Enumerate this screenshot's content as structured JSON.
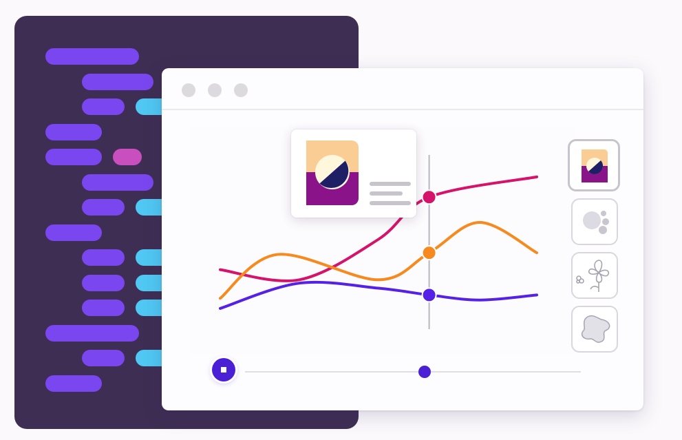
{
  "colors": {
    "code_background": "#3e2e54",
    "code_purple": "#7a46f0",
    "code_cyan": "#4fc8f3",
    "code_pink": "#c94fbf",
    "series_magenta": "#d6136a",
    "series_orange": "#f68a1f",
    "series_violet": "#5521e6",
    "accent": "#4a1fd6"
  },
  "code_editor": {
    "lines": [
      {
        "indent": 0,
        "tokens": [
          {
            "w": 136,
            "c": "purple"
          }
        ]
      },
      {
        "indent": 1,
        "tokens": [
          {
            "w": 104,
            "c": "purple"
          }
        ]
      },
      {
        "indent": 1,
        "tokens": [
          {
            "w": 62,
            "c": "purple"
          },
          {
            "w": 70,
            "c": "cyan"
          }
        ]
      },
      {
        "indent": 0,
        "tokens": [
          {
            "w": 82,
            "c": "purple"
          }
        ]
      },
      {
        "indent": 0,
        "tokens": [
          {
            "w": 82,
            "c": "purple"
          },
          {
            "w": 42,
            "c": "pink"
          }
        ]
      },
      {
        "indent": 1,
        "tokens": [
          {
            "w": 104,
            "c": "purple"
          }
        ]
      },
      {
        "indent": 1,
        "tokens": [
          {
            "w": 62,
            "c": "purple"
          },
          {
            "w": 70,
            "c": "cyan"
          }
        ]
      },
      {
        "indent": 0,
        "tokens": [
          {
            "w": 82,
            "c": "purple"
          }
        ]
      },
      {
        "indent": 1,
        "tokens": [
          {
            "w": 62,
            "c": "purple"
          },
          {
            "w": 70,
            "c": "cyan"
          }
        ]
      },
      {
        "indent": 1,
        "tokens": [
          {
            "w": 62,
            "c": "purple"
          },
          {
            "w": 70,
            "c": "cyan"
          }
        ]
      },
      {
        "indent": 1,
        "tokens": [
          {
            "w": 62,
            "c": "purple"
          },
          {
            "w": 70,
            "c": "cyan"
          }
        ]
      },
      {
        "indent": 0,
        "tokens": [
          {
            "w": 136,
            "c": "purple"
          }
        ]
      },
      {
        "indent": 1,
        "tokens": [
          {
            "w": 62,
            "c": "purple"
          },
          {
            "w": 70,
            "c": "cyan"
          }
        ]
      },
      {
        "indent": 0,
        "tokens": [
          {
            "w": 82,
            "c": "purple"
          }
        ]
      }
    ]
  },
  "window": {
    "controls": [
      "close-dot",
      "minimize-dot",
      "maximize-dot"
    ]
  },
  "chart_data": {
    "type": "line",
    "title": "",
    "xlabel": "",
    "ylabel": "",
    "grid": false,
    "xlim": [
      0,
      1
    ],
    "ylim": [
      0,
      1
    ],
    "hover_x": 0.66,
    "series": [
      {
        "color": "#d6136a",
        "points": [
          [
            0,
            0.32
          ],
          [
            0.25,
            0.26
          ],
          [
            0.5,
            0.5
          ],
          [
            0.66,
            0.75
          ],
          [
            1,
            0.87
          ]
        ]
      },
      {
        "color": "#f68a1f",
        "points": [
          [
            0,
            0.15
          ],
          [
            0.18,
            0.41
          ],
          [
            0.5,
            0.26
          ],
          [
            0.66,
            0.42
          ],
          [
            0.82,
            0.6
          ],
          [
            1,
            0.42
          ]
        ]
      },
      {
        "color": "#5521e6",
        "points": [
          [
            0,
            0.09
          ],
          [
            0.25,
            0.24
          ],
          [
            0.5,
            0.21
          ],
          [
            0.66,
            0.17
          ],
          [
            0.82,
            0.14
          ],
          [
            1,
            0.17
          ]
        ]
      }
    ]
  },
  "tooltip": {
    "image": "sunset-image-icon",
    "text_lines": 3
  },
  "thumbnails": [
    {
      "name": "sunset-image-icon",
      "selected": true
    },
    {
      "name": "bubbles-icon",
      "selected": false
    },
    {
      "name": "flower-sketch-icon",
      "selected": false
    },
    {
      "name": "blob-shape-icon",
      "selected": false
    }
  ],
  "timeline": {
    "progress": 0.55,
    "playing": true
  }
}
